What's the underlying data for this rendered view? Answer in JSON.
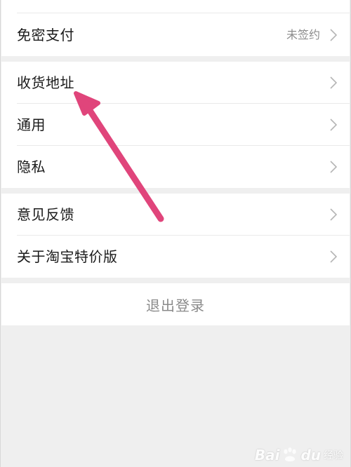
{
  "settings": {
    "group1": {
      "items": [
        {
          "label": "免密支付",
          "value": "未签约"
        }
      ]
    },
    "group2": {
      "items": [
        {
          "label": "收货地址"
        },
        {
          "label": "通用"
        },
        {
          "label": "隐私"
        }
      ]
    },
    "group3": {
      "items": [
        {
          "label": "意见反馈"
        },
        {
          "label": "关于淘宝特价版"
        }
      ]
    },
    "logout_label": "退出登录"
  },
  "annotation": {
    "arrow_color": "#e0457b"
  },
  "watermark": {
    "brand_left": "Bai",
    "brand_right": "du",
    "text": "经验"
  },
  "colors": {
    "background": "#efefef",
    "card": "#ffffff",
    "label": "#1a1a1a",
    "muted": "#8c8c8c"
  }
}
